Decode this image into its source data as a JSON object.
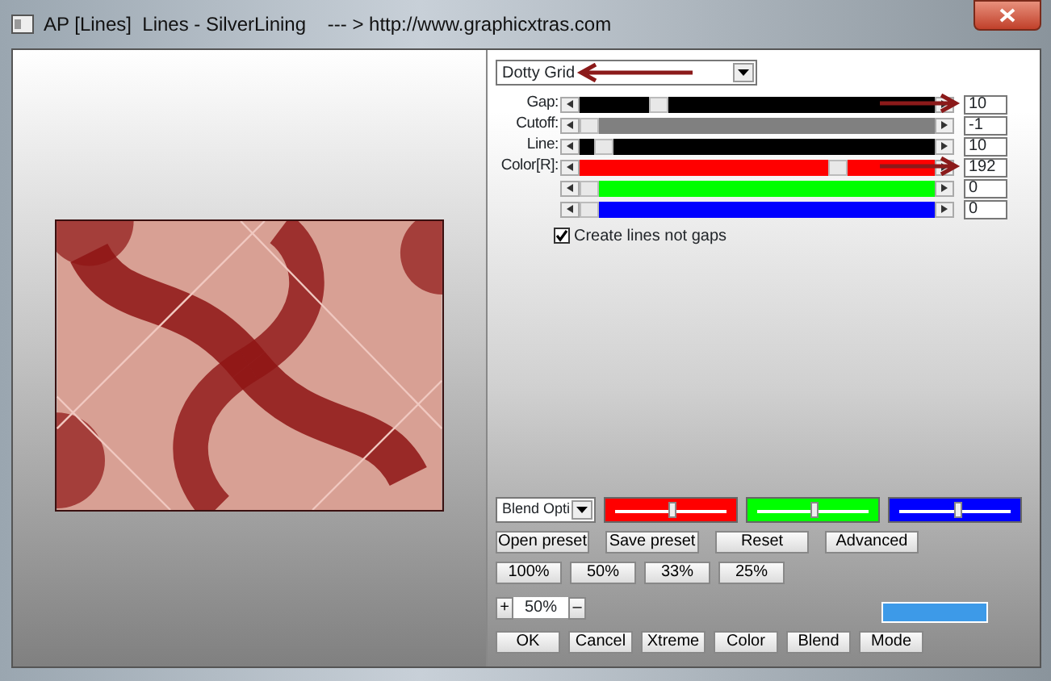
{
  "window": {
    "title": "AP [Lines]  Lines - SilverLining    --- > http://www.graphicxtras.com"
  },
  "pattern_select": {
    "value": "Dotty Grid"
  },
  "sliders": [
    {
      "label": "Gap:",
      "level": 0.2,
      "color": "#000000",
      "value": "10"
    },
    {
      "label": "Cutoff:",
      "level": 0.0,
      "color": "#808080",
      "value": "-1"
    },
    {
      "label": "Line:",
      "level": 0.04,
      "color": "#000000",
      "value": "10"
    },
    {
      "label": "Color[R]:",
      "level": 0.72,
      "color": "#ff0000",
      "value": "192"
    },
    {
      "level": 0.0,
      "color": "#00ff00",
      "value": "0"
    },
    {
      "level": 0.0,
      "color": "#0000ff",
      "value": "0"
    }
  ],
  "checkbox": {
    "label": "Create lines not gaps",
    "checked": true
  },
  "blend": {
    "select": "Blend Opti",
    "sliders": [
      {
        "color": "#ff0000",
        "level": 0.5
      },
      {
        "color": "#00ff00",
        "level": 0.5
      },
      {
        "color": "#0000ff",
        "level": 0.52
      }
    ]
  },
  "preset_buttons": [
    "Open preset",
    "Save preset",
    "Reset",
    "Advanced"
  ],
  "zoom_buttons": [
    "100%",
    "50%",
    "33%",
    "25%"
  ],
  "zoom_stepper": {
    "plus": "+",
    "value": "50%",
    "minus": "–"
  },
  "swatch": {
    "color": "#3d9ae8"
  },
  "buttons": [
    "OK",
    "Cancel",
    "Xtreme",
    "Color",
    "Blend",
    "Mode"
  ]
}
